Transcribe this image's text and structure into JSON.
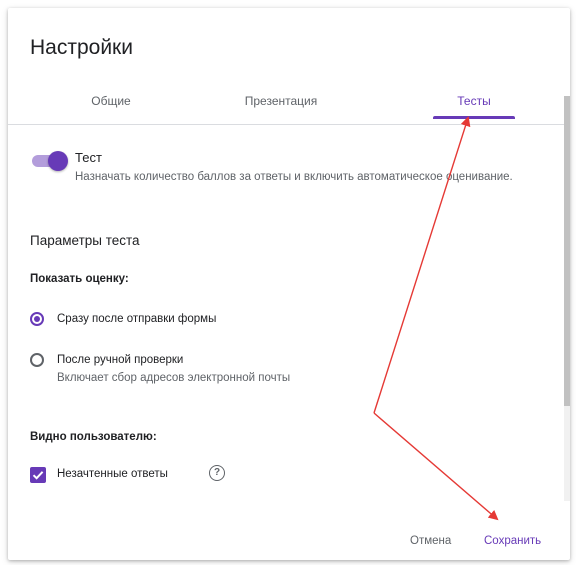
{
  "dialog": {
    "title": "Настройки"
  },
  "tabs": [
    {
      "label": "Общие",
      "active": false
    },
    {
      "label": "Презентация",
      "active": false
    },
    {
      "label": "Тесты",
      "active": true
    }
  ],
  "quiz": {
    "toggle_on": true,
    "label": "Тест",
    "description": "Назначать количество баллов за ответы и включить автоматическое оценивание."
  },
  "params": {
    "title": "Параметры теста",
    "show_score": {
      "label": "Показать оценку:",
      "options": [
        {
          "label": "Сразу после отправки формы",
          "checked": true
        },
        {
          "label": "После ручной проверки",
          "checked": false,
          "description": "Включает сбор адресов электронной почты"
        }
      ]
    },
    "visible": {
      "label": "Видно пользователю:",
      "items": [
        {
          "label": "Незачтенные ответы",
          "checked": true
        }
      ]
    }
  },
  "help_icon": "question-circle-icon",
  "footer": {
    "cancel": "Отмена",
    "save": "Сохранить"
  },
  "colors": {
    "accent": "#673ab7",
    "accent_light": "#b39ddb",
    "annotation": "#e53935"
  }
}
